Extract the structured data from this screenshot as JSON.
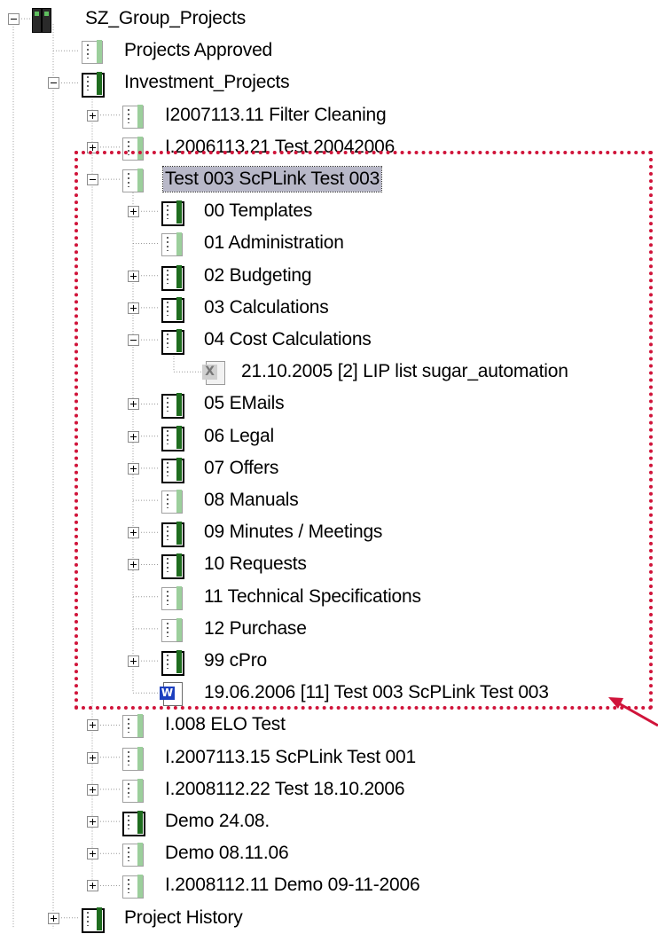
{
  "tree": {
    "nodes": [
      {
        "label": "SZ_Group_Projects",
        "depth": 0,
        "expander": "minus",
        "icon": "root-binder-icon"
      },
      {
        "label": "Projects Approved",
        "depth": 1,
        "expander": "none",
        "icon": "binder-light-icon"
      },
      {
        "label": "Investment_Projects",
        "depth": 1,
        "expander": "minus",
        "icon": "binder-dark-icon"
      },
      {
        "label": "I2007113.11 Filter Cleaning",
        "depth": 2,
        "expander": "plus",
        "icon": "binder-light-icon"
      },
      {
        "label": "I.2006113.21 Test 20042006",
        "depth": 2,
        "expander": "plus",
        "icon": "binder-light-icon"
      },
      {
        "label": "Test 003 ScPLink Test 003",
        "depth": 2,
        "expander": "minus",
        "icon": "binder-light-icon",
        "selected": true
      },
      {
        "label": "00 Templates",
        "depth": 3,
        "expander": "plus",
        "icon": "binder-dark-icon"
      },
      {
        "label": "01 Administration",
        "depth": 3,
        "expander": "none",
        "icon": "binder-light-icon"
      },
      {
        "label": "02 Budgeting",
        "depth": 3,
        "expander": "plus",
        "icon": "binder-dark-icon"
      },
      {
        "label": "03 Calculations",
        "depth": 3,
        "expander": "plus",
        "icon": "binder-dark-icon"
      },
      {
        "label": "04 Cost Calculations",
        "depth": 3,
        "expander": "minus",
        "icon": "binder-dark-icon"
      },
      {
        "label": "21.10.2005  [2] LIP list sugar_automation",
        "depth": 4,
        "expander": "none",
        "icon": "excel-document-icon"
      },
      {
        "label": "05 EMails",
        "depth": 3,
        "expander": "plus",
        "icon": "binder-dark-icon"
      },
      {
        "label": "06 Legal",
        "depth": 3,
        "expander": "plus",
        "icon": "binder-dark-icon"
      },
      {
        "label": "07 Offers",
        "depth": 3,
        "expander": "plus",
        "icon": "binder-dark-icon"
      },
      {
        "label": "08 Manuals",
        "depth": 3,
        "expander": "none",
        "icon": "binder-light-icon"
      },
      {
        "label": "09 Minutes / Meetings",
        "depth": 3,
        "expander": "plus",
        "icon": "binder-dark-icon"
      },
      {
        "label": "10 Requests",
        "depth": 3,
        "expander": "plus",
        "icon": "binder-dark-icon"
      },
      {
        "label": "11 Technical Specifications",
        "depth": 3,
        "expander": "none",
        "icon": "binder-light-icon"
      },
      {
        "label": "12 Purchase",
        "depth": 3,
        "expander": "none",
        "icon": "binder-light-icon"
      },
      {
        "label": "99 cPro",
        "depth": 3,
        "expander": "plus",
        "icon": "binder-dark-icon"
      },
      {
        "label": "19.06.2006  [11] Test 003 ScPLink Test 003",
        "depth": 3,
        "expander": "none",
        "icon": "word-document-icon"
      },
      {
        "label": "I.008 ELO Test",
        "depth": 2,
        "expander": "plus",
        "icon": "binder-light-icon"
      },
      {
        "label": "I.2007113.15 ScPLink Test 001",
        "depth": 2,
        "expander": "plus",
        "icon": "binder-light-icon"
      },
      {
        "label": "I.2008112.22 Test 18.10.2006",
        "depth": 2,
        "expander": "plus",
        "icon": "binder-light-icon"
      },
      {
        "label": "Demo 24.08.",
        "depth": 2,
        "expander": "plus",
        "icon": "binder-dark-icon"
      },
      {
        "label": "Demo 08.11.06",
        "depth": 2,
        "expander": "plus",
        "icon": "binder-light-icon"
      },
      {
        "label": "I.2008112.11 Demo 09-11-2006",
        "depth": 2,
        "expander": "plus",
        "icon": "binder-light-icon"
      },
      {
        "label": "Project History",
        "depth": 1,
        "expander": "plus",
        "icon": "binder-dark-icon"
      }
    ]
  },
  "colors": {
    "highlight_border": "#d0143a",
    "arrow": "#d0143a",
    "selection_bg": "#b8b8c8",
    "binder_spine": "#2d7a2d"
  }
}
